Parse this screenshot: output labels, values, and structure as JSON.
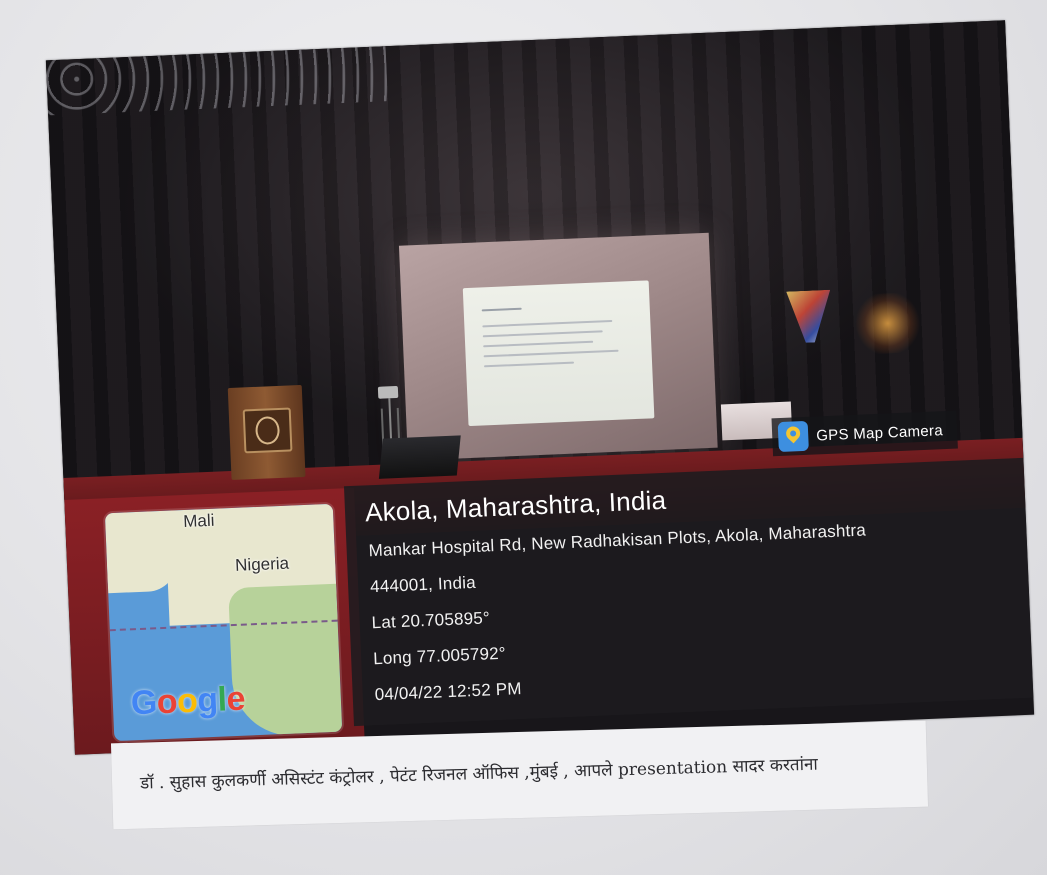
{
  "photo": {
    "watermark_app": "GPS Map Camera",
    "location": {
      "title": "Akola, Maharashtra, India",
      "address_line1": "Mankar Hospital Rd, New Radhakisan Plots, Akola, Maharashtra",
      "address_line2": "444001, India",
      "lat": "Lat 20.705895°",
      "long": "Long 77.005792°",
      "datetime": "04/04/22 12:52 PM"
    },
    "map": {
      "labels": [
        "Mali",
        "Nigeria"
      ],
      "provider_logo": "Google",
      "colors": {
        "water": "#5a9bd8",
        "land": "#e8e7cf"
      }
    }
  },
  "caption": {
    "text": "डॉ . सुहास कुलकर्णी असिस्टंट कंट्रोलर , पेटंट रिजनल ऑफिस ,मुंबई , आपले  presentation सादर करतांना"
  }
}
